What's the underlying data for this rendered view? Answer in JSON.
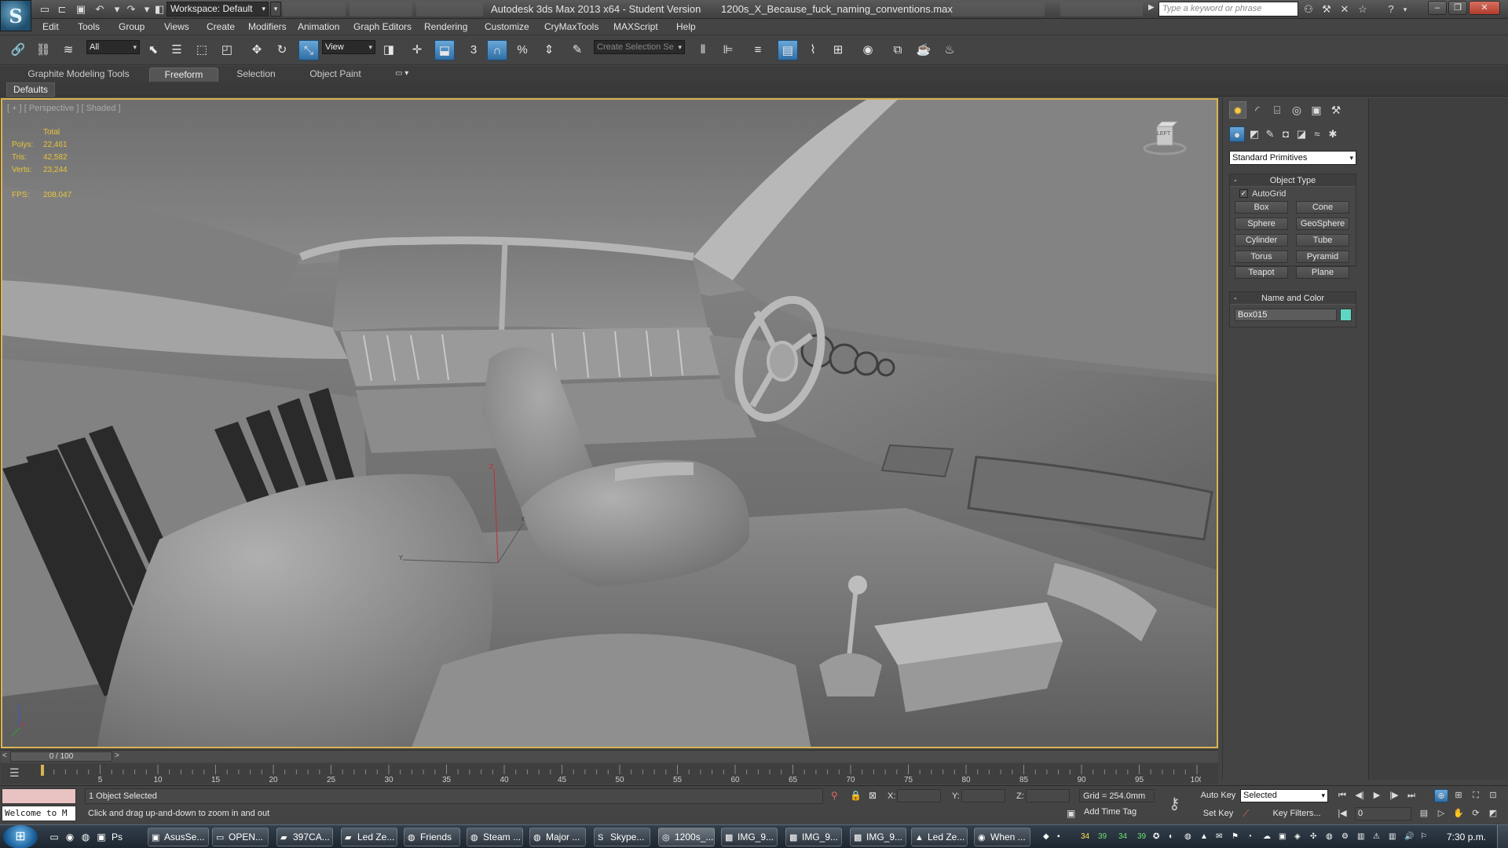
{
  "titlebar": {
    "app_logo": "S",
    "workspace": "Workspace: Default",
    "app_title": "Autodesk 3ds Max  2013 x64   - Student Version",
    "file_name": "1200s_X_Because_fuck_naming_conventions.max",
    "search_placeholder": "Type a keyword or phrase"
  },
  "menu": [
    "Edit",
    "Tools",
    "Group",
    "Views",
    "Create",
    "Modifiers",
    "Animation",
    "Graph Editors",
    "Rendering",
    "Customize",
    "CryMaxTools",
    "MAXScript",
    "Help"
  ],
  "toolbar": {
    "filter": "All",
    "ref_coord": "View",
    "snap_3": "3",
    "angle_snap": "%",
    "named_selection_placeholder": "Create Selection Se"
  },
  "ribbon": {
    "tabs": [
      "Graphite Modeling Tools",
      "Freeform",
      "Selection",
      "Object Paint"
    ],
    "active_tab": "Freeform",
    "defaults_label": "Defaults"
  },
  "viewport": {
    "label": "[ + ] [ Perspective ] [ Shaded ]",
    "stats": {
      "header": "Total",
      "polys_label": "Polys:",
      "polys": "22,461",
      "tris_label": "Tris:",
      "tris": "42,582",
      "verts_label": "Verts:",
      "verts": "23,244",
      "fps_label": "FPS:",
      "fps": "208.047"
    },
    "viewcube_label": "LEFT",
    "gizmo_labels": {
      "z": "Z",
      "y": "Y",
      "x": "X"
    },
    "colors": {
      "border": "#d9b550",
      "stats": "#e8c43a"
    }
  },
  "command_panel": {
    "category": "Standard Primitives",
    "object_type_title": "Object Type",
    "autogrid_label": "AutoGrid",
    "autogrid_checked": true,
    "primitives": [
      "Box",
      "Cone",
      "Sphere",
      "GeoSphere",
      "Cylinder",
      "Tube",
      "Torus",
      "Pyramid",
      "Teapot",
      "Plane"
    ],
    "name_color_title": "Name and Color",
    "object_name": "Box015",
    "object_color": "#5ed6c3"
  },
  "timeline": {
    "frame_counter": "0 / 100",
    "ticks": [
      5,
      10,
      15,
      20,
      25,
      30,
      35,
      40,
      45,
      50,
      55,
      60,
      65,
      70,
      75,
      80,
      85,
      90,
      95,
      100
    ]
  },
  "status": {
    "maxscript_text": "Welcome to M",
    "selection": "1 Object Selected",
    "prompt": "Click and drag up-and-down to zoom in and out",
    "x_label": "X:",
    "y_label": "Y:",
    "z_label": "Z:",
    "grid": "Grid = 254.0mm",
    "add_time_tag": "Add Time Tag",
    "auto_key": "Auto Key",
    "set_key": "Set Key",
    "keys_filter_value": "Selected",
    "key_filters": "Key Filters...",
    "current_frame": "0"
  },
  "taskbar": {
    "tasks": [
      "AsusSe...",
      "OPEN...",
      "397CA...",
      "Led Ze...",
      "Friends",
      "Steam ...",
      "Major ...",
      "Skype...",
      "1200s_...",
      "IMG_9...",
      "IMG_9...",
      "IMG_9...",
      "Led Ze...",
      "When ..."
    ],
    "tray_numbers": [
      "34",
      "39",
      "34",
      "39"
    ],
    "clock": "7:30 p.m."
  }
}
